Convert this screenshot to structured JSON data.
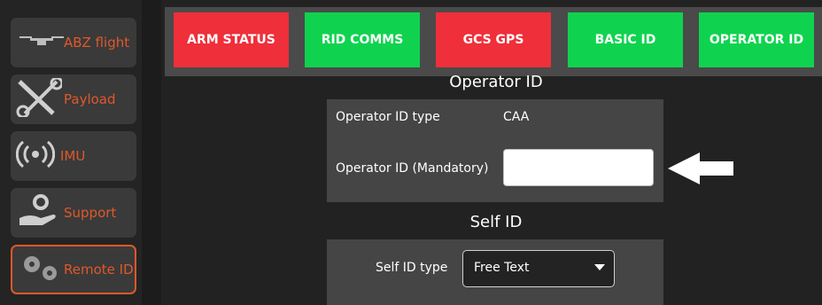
{
  "sidebar": {
    "items": [
      {
        "label": "ABZ flight",
        "icon": "drone-icon"
      },
      {
        "label": "Payload",
        "icon": "tools-icon"
      },
      {
        "label": "IMU",
        "icon": "signal-icon"
      },
      {
        "label": "Support",
        "icon": "support-hand-gear-icon"
      },
      {
        "label": "Remote ID",
        "icon": "gears-icon",
        "active": true
      }
    ]
  },
  "status_bar": {
    "buttons": [
      {
        "label": "ARM STATUS",
        "state": "red"
      },
      {
        "label": "RID COMMS",
        "state": "green"
      },
      {
        "label": "GCS GPS",
        "state": "red"
      },
      {
        "label": "BASIC ID",
        "state": "green"
      },
      {
        "label": "OPERATOR ID",
        "state": "green"
      }
    ]
  },
  "operator_id": {
    "title": "Operator ID",
    "type_label": "Operator ID type",
    "type_value": "CAA",
    "id_label": "Operator ID (Mandatory)",
    "id_value": ""
  },
  "self_id": {
    "title": "Self ID",
    "type_label": "Self ID type",
    "type_value": "Free Text"
  },
  "colors": {
    "accent": "#e0582a",
    "red": "#ef2f3a",
    "green": "#0fd34f",
    "panel": "#454545",
    "background": "#222222"
  }
}
